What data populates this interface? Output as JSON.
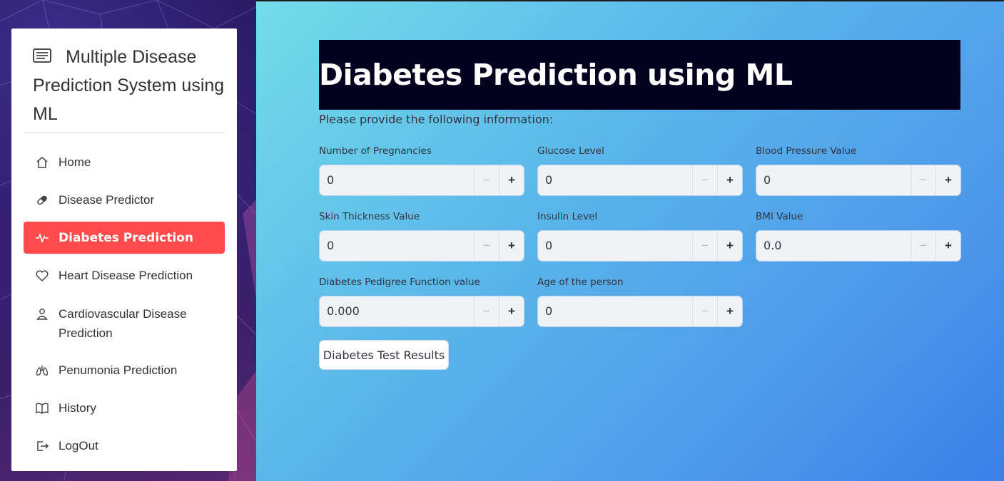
{
  "sidebar": {
    "title": "Multiple Disease Prediction System using ML",
    "items": [
      {
        "label": "Home",
        "icon": "house-icon"
      },
      {
        "label": "Disease Predictor",
        "icon": "capsule-icon"
      },
      {
        "label": "Diabetes Prediction",
        "icon": "activity-icon",
        "active": true
      },
      {
        "label": "Heart Disease Prediction",
        "icon": "heart-icon"
      },
      {
        "label": "Cardiovascular Disease Prediction",
        "icon": "person-icon"
      },
      {
        "label": "Penumonia Prediction",
        "icon": "lungs-icon"
      },
      {
        "label": "History",
        "icon": "book-icon"
      },
      {
        "label": "LogOut",
        "icon": "logout-icon"
      }
    ],
    "accent": "#ff4b4b"
  },
  "main": {
    "title": "Diabetes Prediction using ML",
    "subtitle": "Please provide the following information:",
    "fields": [
      {
        "label": "Number of Pregnancies",
        "value": "0"
      },
      {
        "label": "Glucose Level",
        "value": "0"
      },
      {
        "label": "Blood Pressure Value",
        "value": "0"
      },
      {
        "label": "Skin Thickness Value",
        "value": "0"
      },
      {
        "label": "Insulin Level",
        "value": "0"
      },
      {
        "label": "BMI Value",
        "value": "0.0"
      },
      {
        "label": "Diabetes Pedigree Function value",
        "value": "0.000"
      },
      {
        "label": "Age of the person",
        "value": "0"
      }
    ],
    "stepper": {
      "minus": "−",
      "plus": "+"
    },
    "button_label": "Diabetes Test Results"
  }
}
